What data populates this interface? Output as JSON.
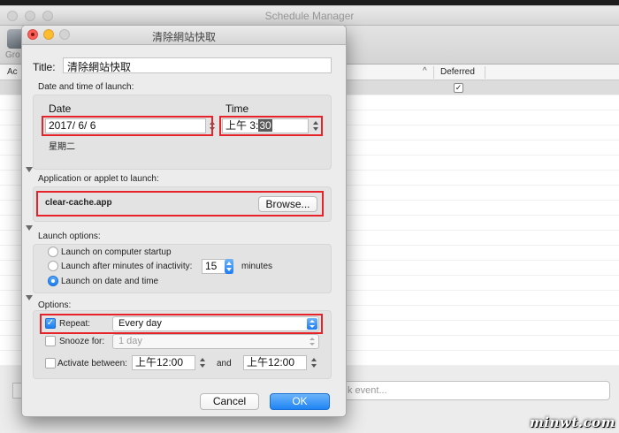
{
  "background_window": {
    "title": "Schedule Manager",
    "toolbar_label": "Gro",
    "columns": {
      "ac": "Ac",
      "deferred": "Deferred"
    },
    "deferred_checked": true,
    "search_placeholder": "k event..."
  },
  "dialog": {
    "window_title": "清除網站快取",
    "title_label": "Title:",
    "title_value": "清除網站快取",
    "date_time": {
      "section_label": "Date and time of launch:",
      "date_header": "Date",
      "time_header": "Time",
      "date_value": "2017/  6/  6",
      "time_prefix": "上午  3:",
      "time_highlight": "30",
      "weekday": "星期二"
    },
    "application": {
      "section_label": "Application or applet to launch:",
      "app_name": "clear-cache.app",
      "browse_label": "Browse..."
    },
    "launch_options": {
      "section_label": "Launch options:",
      "startup_label": "Launch on computer startup",
      "inactivity_label": "Launch after minutes of inactivity:",
      "inactivity_value": "15",
      "minutes_label": "minutes",
      "date_time_label": "Launch on date and time",
      "selected": "date_time"
    },
    "options": {
      "section_label": "Options:",
      "repeat_label": "Repeat:",
      "repeat_checked": true,
      "repeat_value": "Every day",
      "snooze_label": "Snooze for:",
      "snooze_checked": false,
      "snooze_value": "1 day",
      "activate_label": "Activate between:",
      "activate_checked": false,
      "activate_from": "上午12:00",
      "and_label": "and",
      "activate_to": "上午12:00"
    },
    "cancel_label": "Cancel",
    "ok_label": "OK"
  },
  "watermark": "minwt.com",
  "colors": {
    "highlight_box": "#e8222b",
    "accent": "#1f84f3"
  }
}
